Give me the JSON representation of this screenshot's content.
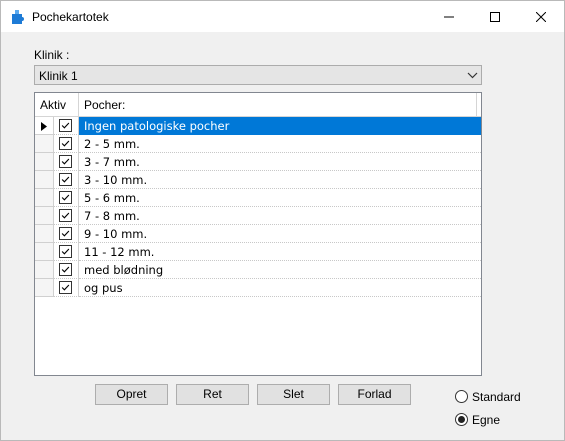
{
  "window": {
    "title": "Pochekartotek"
  },
  "klinik": {
    "label": "Klinik :",
    "selected": "Klinik 1"
  },
  "grid": {
    "headers": {
      "aktiv": "Aktiv",
      "pocher": "Pocher:"
    },
    "rows": [
      {
        "label": "Ingen patologiske pocher",
        "aktiv": true,
        "selected": true
      },
      {
        "label": "2 - 5 mm.",
        "aktiv": true
      },
      {
        "label": "3 - 7 mm.",
        "aktiv": true
      },
      {
        "label": "3 - 10 mm.",
        "aktiv": true
      },
      {
        "label": "5 - 6 mm.",
        "aktiv": true
      },
      {
        "label": "7 - 8 mm.",
        "aktiv": true
      },
      {
        "label": "9 - 10 mm.",
        "aktiv": true
      },
      {
        "label": "11 - 12 mm.",
        "aktiv": true
      },
      {
        "label": "med blødning",
        "aktiv": true
      },
      {
        "label": "og pus",
        "aktiv": true
      }
    ]
  },
  "buttons": {
    "opret": "Opret",
    "ret": "Ret",
    "slet": "Slet",
    "forlad": "Forlad"
  },
  "radio": {
    "standard": "Standard",
    "egne": "Egne",
    "selected": "egne"
  },
  "colors": {
    "selection": "#0078d7",
    "app_icon": "#1e7bd6"
  }
}
